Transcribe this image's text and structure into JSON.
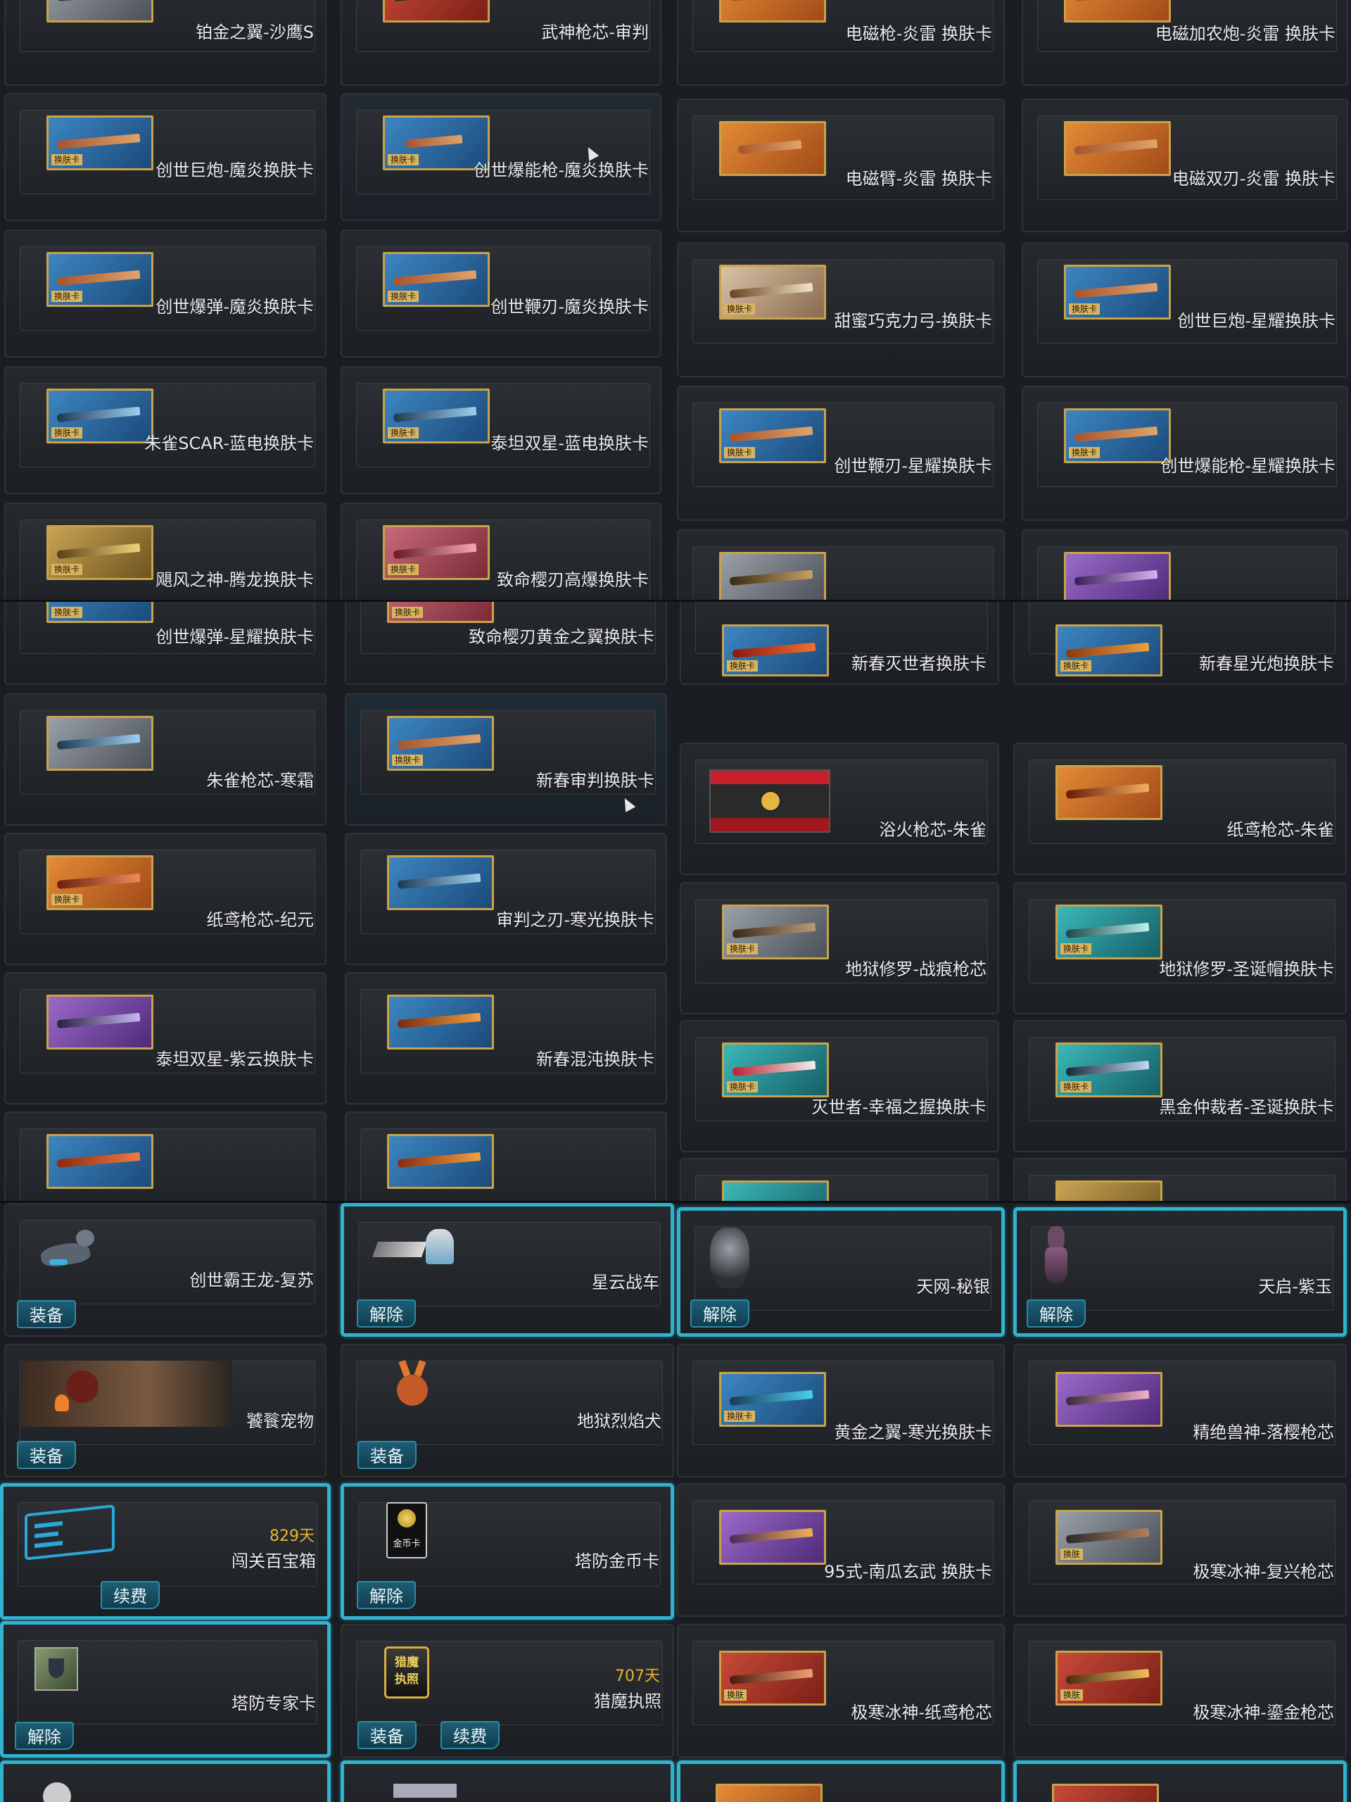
{
  "panel1_left": [
    {
      "name": "铂金之翼-沙鹰S"
    },
    {
      "name": "武神枪芯-审判"
    },
    {
      "name": "创世巨炮-魔炎换肤卡",
      "tag": "换肤卡"
    },
    {
      "name": "创世爆能枪-魔炎换肤卡",
      "tag": "换肤卡"
    },
    {
      "name": "创世爆弹-魔炎换肤卡",
      "tag": "换肤卡"
    },
    {
      "name": "创世鞭刃-魔炎换肤卡",
      "tag": "换肤卡"
    },
    {
      "name": "朱雀SCAR-蓝电换肤卡",
      "tag": "换肤卡"
    },
    {
      "name": "泰坦双星-蓝电换肤卡",
      "tag": "换肤卡"
    },
    {
      "name": "飓风之神-腾龙换肤卡",
      "tag": "换肤卡"
    },
    {
      "name": "致命樱刃高爆换肤卡",
      "tag": "换肤卡"
    }
  ],
  "panel1_right": [
    {
      "name": "电磁枪-炎雷 换肤卡"
    },
    {
      "name": "电磁加农炮-炎雷 换肤卡"
    },
    {
      "name": "电磁臂-炎雷 换肤卡"
    },
    {
      "name": "电磁双刃-炎雷 换肤卡"
    },
    {
      "name": "甜蜜巧克力弓-换肤卡",
      "tag": "换肤卡"
    },
    {
      "name": "创世巨炮-星耀换肤卡",
      "tag": "换肤卡"
    },
    {
      "name": "创世鞭刃-星耀换肤卡",
      "tag": "换肤卡"
    },
    {
      "name": "创世爆能枪-星耀换肤卡",
      "tag": "换肤卡"
    }
  ],
  "panel2_left": [
    {
      "name": "创世爆弹-星耀换肤卡",
      "tag": "换肤卡"
    },
    {
      "name": "致命樱刃黄金之翼换肤卡",
      "tag": "换肤卡"
    },
    {
      "name": "朱雀枪芯-寒霜"
    },
    {
      "name": "新春审判换肤卡",
      "tag": "换肤卡"
    },
    {
      "name": "纸鸢枪芯-纪元",
      "tag": "换肤卡"
    },
    {
      "name": "审判之刃-寒光换肤卡"
    },
    {
      "name": "泰坦双星-紫云换肤卡"
    },
    {
      "name": "新春混沌换肤卡"
    }
  ],
  "panel2_right": [
    {
      "name": "新春灭世者换肤卡",
      "tag": "换肤卡"
    },
    {
      "name": "新春星光炮换肤卡",
      "tag": "换肤卡"
    },
    {
      "name": "浴火枪芯-朱雀"
    },
    {
      "name": "纸鸢枪芯-朱雀"
    },
    {
      "name": "地狱修罗-战痕枪芯",
      "tag": "换肤卡"
    },
    {
      "name": "地狱修罗-圣诞帽换肤卡",
      "tag": "换肤卡"
    },
    {
      "name": "灭世者-幸福之握换肤卡",
      "tag": "换肤卡"
    },
    {
      "name": "黑金仲裁者-圣诞换肤卡",
      "tag": "换肤卡"
    }
  ],
  "panel3": [
    {
      "name": "创世霸王龙-复苏",
      "button": "装备"
    },
    {
      "name": "星云战车",
      "button": "解除"
    },
    {
      "name": "天网-秘银",
      "button": "解除"
    },
    {
      "name": "天启-紫玉",
      "button": "解除"
    },
    {
      "name": "饕餮宠物",
      "button": "装备"
    },
    {
      "name": "地狱烈焰犬",
      "button": "装备"
    },
    {
      "name": "黄金之翼-寒光换肤卡",
      "tag": "换肤卡"
    },
    {
      "name": "精绝兽神-落樱枪芯"
    },
    {
      "name": "闯关百宝箱",
      "days": "829天",
      "button": "续费"
    },
    {
      "name": "塔防金币卡",
      "button": "解除",
      "icon_text": "金币卡"
    },
    {
      "name": "95式-南瓜玄武 换肤卡"
    },
    {
      "name": "极寒冰神-复兴枪芯",
      "tag": "换肤"
    },
    {
      "name": "塔防专家卡",
      "button": "解除"
    },
    {
      "name": "猎魔执照",
      "days": "707天",
      "button": "装备",
      "button2": "续费",
      "icon_text": "猎魔执照"
    },
    {
      "name": "极寒冰神-纸鸢枪芯",
      "tag": "换肤"
    },
    {
      "name": "极寒冰神-鎏金枪芯",
      "tag": "换肤"
    }
  ],
  "colors": {
    "highlight": "#2fb3cf",
    "days": "#e8b430",
    "frame": "#c9a24a"
  }
}
